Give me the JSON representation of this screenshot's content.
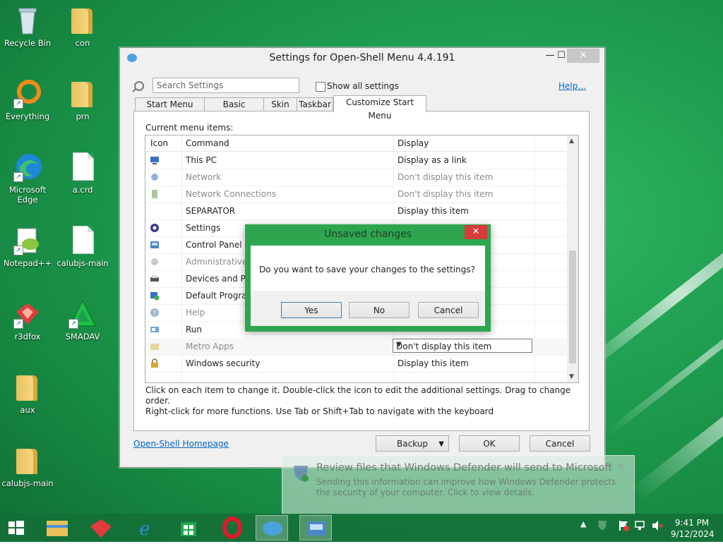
{
  "desktop": {
    "icons": [
      {
        "label": "Recycle Bin"
      },
      {
        "label": "con"
      },
      {
        "label": "Everything"
      },
      {
        "label": "prn"
      },
      {
        "label": "Microsoft Edge"
      },
      {
        "label": "a.crd"
      },
      {
        "label": "Notepad++"
      },
      {
        "label": "calubjs-main"
      },
      {
        "label": "r3dfox"
      },
      {
        "label": "SMADAV"
      },
      {
        "label": "aux"
      },
      {
        "label": "calubjs-main"
      }
    ]
  },
  "window": {
    "title": "Settings for Open-Shell Menu 4.4.191",
    "search_placeholder": "Search Settings",
    "show_all_label": "Show all settings",
    "help_link": "Help...",
    "tabs": [
      {
        "label": "Start Menu Style"
      },
      {
        "label": "Basic Settings"
      },
      {
        "label": "Skin"
      },
      {
        "label": "Taskbar"
      },
      {
        "label": "Customize Start Menu"
      }
    ],
    "current_items_label": "Current menu items:",
    "columns": {
      "icon": "Icon",
      "command": "Command",
      "display": "Display"
    },
    "rows": [
      {
        "command": "This PC",
        "display": "Display as a link"
      },
      {
        "command": "Network",
        "display": "Don't display this item"
      },
      {
        "command": "Network Connections",
        "display": "Don't display this item"
      },
      {
        "command": "SEPARATOR",
        "display": "Display this item"
      },
      {
        "command": "Settings",
        "display": ""
      },
      {
        "command": "Control Panel",
        "display": ""
      },
      {
        "command": "Administrative T",
        "display": ""
      },
      {
        "command": "Devices and Prin",
        "display": ""
      },
      {
        "command": "Default Program",
        "display": ""
      },
      {
        "command": "Help",
        "display": ""
      },
      {
        "command": "Run",
        "display": ""
      },
      {
        "command": "Metro Apps",
        "display": "Don't display this item"
      },
      {
        "command": "Windows security",
        "display": "Display this item"
      }
    ],
    "hint_line1": "Click on each item to change it. Double-click the icon to edit the additional settings. Drag to change order.",
    "hint_line2": "Right-click for more functions. Use Tab or Shift+Tab to navigate with the keyboard",
    "homepage_link": "Open-Shell Homepage",
    "backup_label": "Backup",
    "ok_label": "OK",
    "cancel_label": "Cancel"
  },
  "dialog": {
    "title": "Unsaved changes",
    "message": "Do you want to save your changes to the settings?",
    "yes_label": "Yes",
    "no_label": "No",
    "cancel_label": "Cancel"
  },
  "toast": {
    "title": "Review files that Windows Defender will send to Microsoft",
    "text": "Sending this information can improve how Windows Defender protects the security of your computer. Click to view details."
  },
  "clock": {
    "time": "9:41 PM",
    "date": "9/12/2024"
  }
}
